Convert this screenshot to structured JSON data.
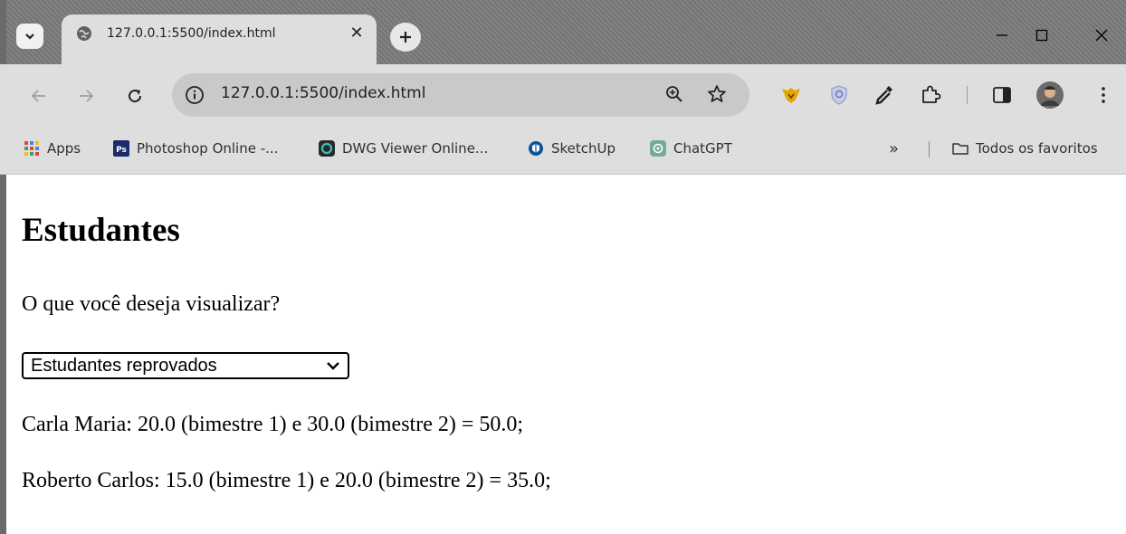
{
  "browser": {
    "tab": {
      "title": "127.0.0.1:5500/index.html"
    },
    "address": {
      "url": "127.0.0.1:5500/index.html"
    },
    "bookmarks": [
      {
        "label": "Apps",
        "icon": "apps-grid-icon"
      },
      {
        "label": "Photoshop Online -...",
        "icon": "photoshop-icon"
      },
      {
        "label": "DWG Viewer Online...",
        "icon": "dwg-viewer-icon"
      },
      {
        "label": "SketchUp",
        "icon": "sketchup-icon"
      },
      {
        "label": "ChatGPT",
        "icon": "chatgpt-icon"
      }
    ],
    "bookmarks_overflow": "»",
    "all_bookmarks": "Todos os favoritos"
  },
  "page": {
    "title": "Estudantes",
    "prompt": "O que você deseja visualizar?",
    "select": {
      "selected": "Estudantes reprovados"
    },
    "results": [
      "Carla Maria: 20.0 (bimestre 1) e 30.0 (bimestre 2) = 50.0;",
      "Roberto Carlos: 15.0 (bimestre 1) e 20.0 (bimestre 2) = 35.0;"
    ]
  },
  "colors": {
    "tabstrip": "#7b7b7b",
    "toolbar": "#dedede",
    "omnibox": "#c9c9c9",
    "brave_lion": "#e8a400"
  }
}
